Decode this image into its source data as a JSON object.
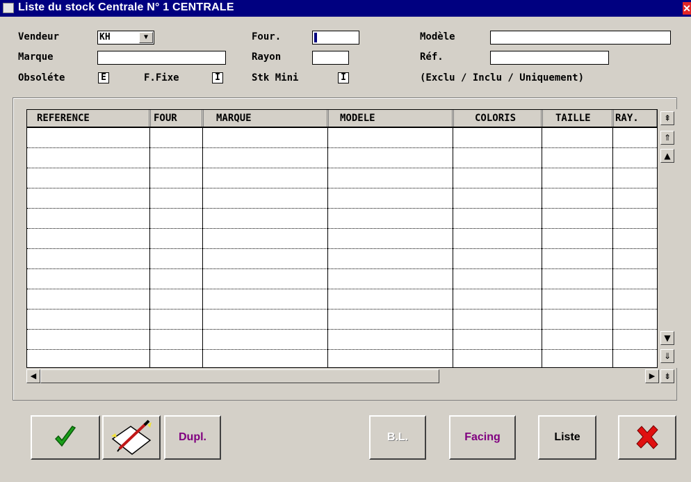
{
  "window": {
    "title": "Liste du stock Centrale N° 1 CENTRALE",
    "close_glyph": "✕"
  },
  "filters": {
    "vendeur_label": "Vendeur",
    "vendeur_value": "KH",
    "four_label": "Four.",
    "four_value": "",
    "modele_label": "Modèle",
    "modele_value": "",
    "marque_label": "Marque",
    "marque_value": "",
    "rayon_label": "Rayon",
    "rayon_value": "",
    "ref_label": "Réf.",
    "ref_value": "",
    "obsolete_label": "Obsoléte",
    "obsolete_value": "E",
    "ffixe_label": "F.Fixe",
    "ffixe_value": "I",
    "stkmini_label": "Stk Mini",
    "stkmini_value": "I",
    "legend": "(Exclu / Inclu / Uniquement)"
  },
  "table": {
    "columns": [
      "REFERENCE",
      "FOUR",
      "MARQUE",
      "MODELE",
      "COLORIS",
      "TAILLE",
      "RAY."
    ],
    "rows": []
  },
  "buttons": {
    "ok_icon": "checkmark-icon",
    "edit_icon": "note-pencil-icon",
    "dupl": "Dupl.",
    "bl": "B.L.",
    "facing": "Facing",
    "liste": "Liste",
    "cancel_icon": "red-x-icon"
  },
  "colors": {
    "titlebar": "#000080",
    "face": "#d4d0c8",
    "dupl_text": "#800080",
    "facing_text": "#800080",
    "disabled_text": "#ffffff",
    "ok_green": "#1aa01a",
    "cancel_red": "#e01010"
  }
}
